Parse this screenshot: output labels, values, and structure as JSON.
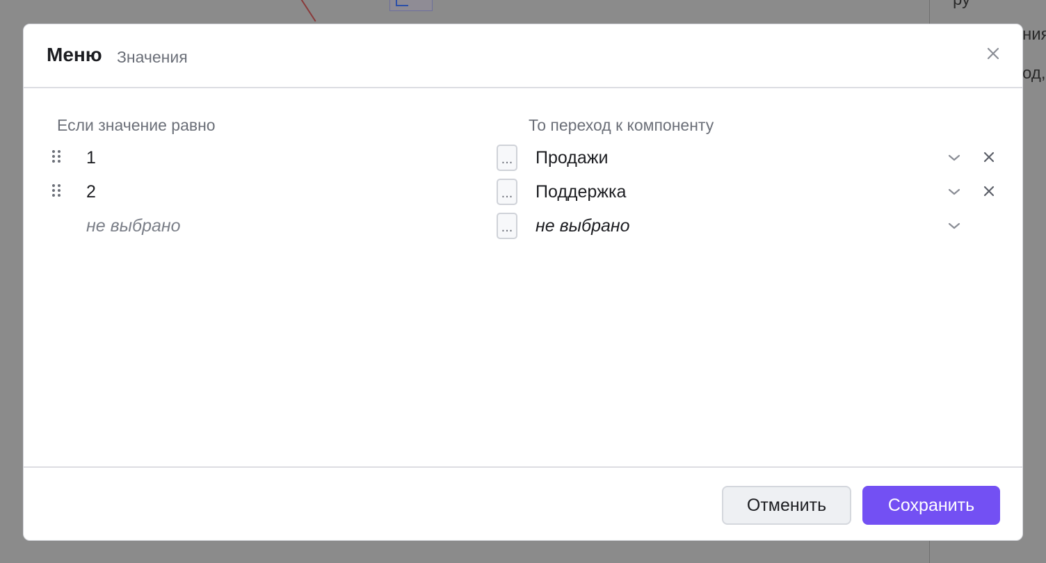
{
  "background": {
    "side_texts": [
      "ру",
      "ния",
      "од,"
    ]
  },
  "modal": {
    "title": "Меню",
    "subtitle": "Значения",
    "columns": {
      "value_label": "Если значение равно",
      "target_label": "То переход к компоненту"
    },
    "rows": [
      {
        "value": "1",
        "target": "Продажи"
      },
      {
        "value": "2",
        "target": "Поддержка"
      }
    ],
    "new_row": {
      "value_placeholder": "не выбрано",
      "target_placeholder": "не выбрано"
    },
    "dots_label": "...",
    "buttons": {
      "cancel": "Отменить",
      "save": "Сохранить"
    }
  },
  "colors": {
    "accent": "#7350f3",
    "overlay": "#8b8b8b"
  },
  "icons": {
    "close": "close-icon",
    "drag": "drag-handle-icon",
    "chevron": "chevron-down-icon",
    "remove": "remove-icon"
  }
}
